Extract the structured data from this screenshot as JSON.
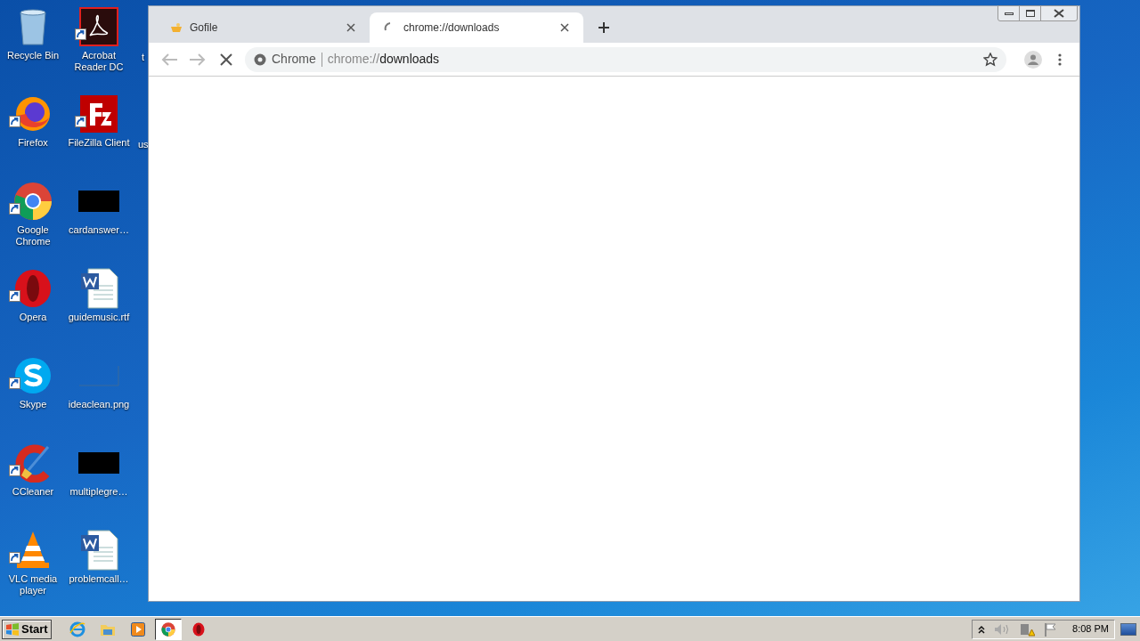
{
  "desktop": {
    "icons": [
      {
        "label": "Recycle Bin",
        "kind": "bin",
        "shortcut": false
      },
      {
        "label": "Acrobat Reader DC",
        "kind": "pdf",
        "shortcut": true
      },
      {
        "label": "Firefox",
        "kind": "fox",
        "shortcut": true
      },
      {
        "label": "FileZilla Client",
        "kind": "fz",
        "shortcut": true
      },
      {
        "label": "Google Chrome",
        "kind": "chrome",
        "shortcut": true
      },
      {
        "label": "cardanswer…",
        "kind": "dark",
        "shortcut": false
      },
      {
        "label": "Opera",
        "kind": "opera",
        "shortcut": true
      },
      {
        "label": "guidemusic.rtf",
        "kind": "doc",
        "shortcut": false
      },
      {
        "label": "Skype",
        "kind": "skype",
        "shortcut": true
      },
      {
        "label": "ideaclean.png",
        "kind": "blank",
        "shortcut": false
      },
      {
        "label": "CCleaner",
        "kind": "ccleaner",
        "shortcut": true
      },
      {
        "label": "multiplegre…",
        "kind": "dark",
        "shortcut": false
      },
      {
        "label": "VLC media player",
        "kind": "cone",
        "shortcut": true
      },
      {
        "label": "problemcall…",
        "kind": "doc",
        "shortcut": false
      }
    ],
    "partial_labels": [
      "t",
      "us"
    ]
  },
  "browser": {
    "tabs": [
      {
        "title": "Gofile",
        "selected": false,
        "loading": false
      },
      {
        "title": "chrome://downloads",
        "selected": true,
        "loading": true
      }
    ],
    "address": {
      "site": "Chrome",
      "scheme": "chrome://",
      "path": "downloads"
    }
  },
  "taskbar": {
    "start": "Start",
    "apps": [
      {
        "kind": "ie",
        "selected": false
      },
      {
        "kind": "folder",
        "selected": false
      },
      {
        "kind": "media",
        "selected": false
      },
      {
        "kind": "chrome",
        "selected": true
      },
      {
        "kind": "opera",
        "selected": false
      }
    ],
    "clock": "8:08 PM"
  }
}
